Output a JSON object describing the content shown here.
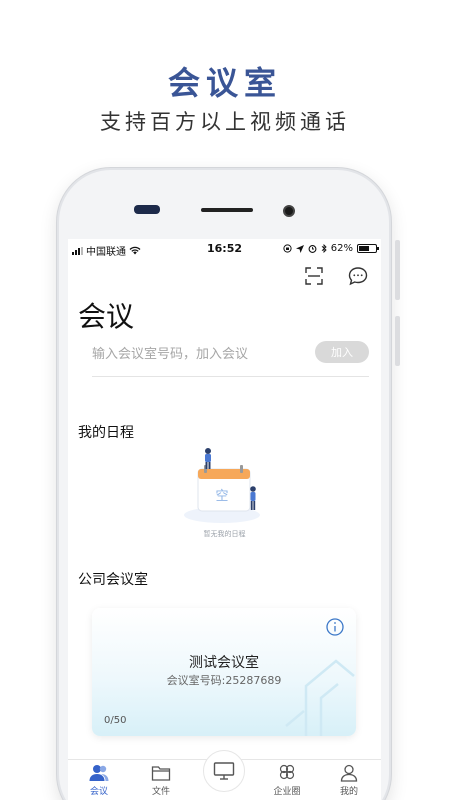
{
  "promo": {
    "title": "会议室",
    "subtitle": "支持百方以上视频通话"
  },
  "status_bar": {
    "carrier": "中国联通",
    "time": "16:52",
    "battery": "62%",
    "battery_level": 0.62
  },
  "header": {
    "title": "会议",
    "scan_icon": "scan-icon",
    "message_icon": "chat-bubble-icon"
  },
  "join": {
    "placeholder": "输入会议室号码，加入会议",
    "button_label": "加入"
  },
  "schedule": {
    "title": "我的日程",
    "calendar_text": "空",
    "empty_text": "暂无我的日程"
  },
  "company_rooms": {
    "title": "公司会议室",
    "room": {
      "name": "测试会议室",
      "number_label": "会议室号码:25287689",
      "capacity": "0/50"
    }
  },
  "tabbar": {
    "items": [
      {
        "label": "会议",
        "icon": "meeting-user-icon",
        "active": true
      },
      {
        "label": "文件",
        "icon": "folder-icon",
        "active": false
      },
      {
        "label": "",
        "icon": "monitor-icon",
        "active": false
      },
      {
        "label": "企业圈",
        "icon": "clover-icon",
        "active": false
      },
      {
        "label": "我的",
        "icon": "person-icon",
        "active": false
      }
    ]
  },
  "colors": {
    "brand_blue": "#3a5596",
    "active_tab": "#3562c9",
    "card_gradient_end": "#d7f0f8"
  }
}
